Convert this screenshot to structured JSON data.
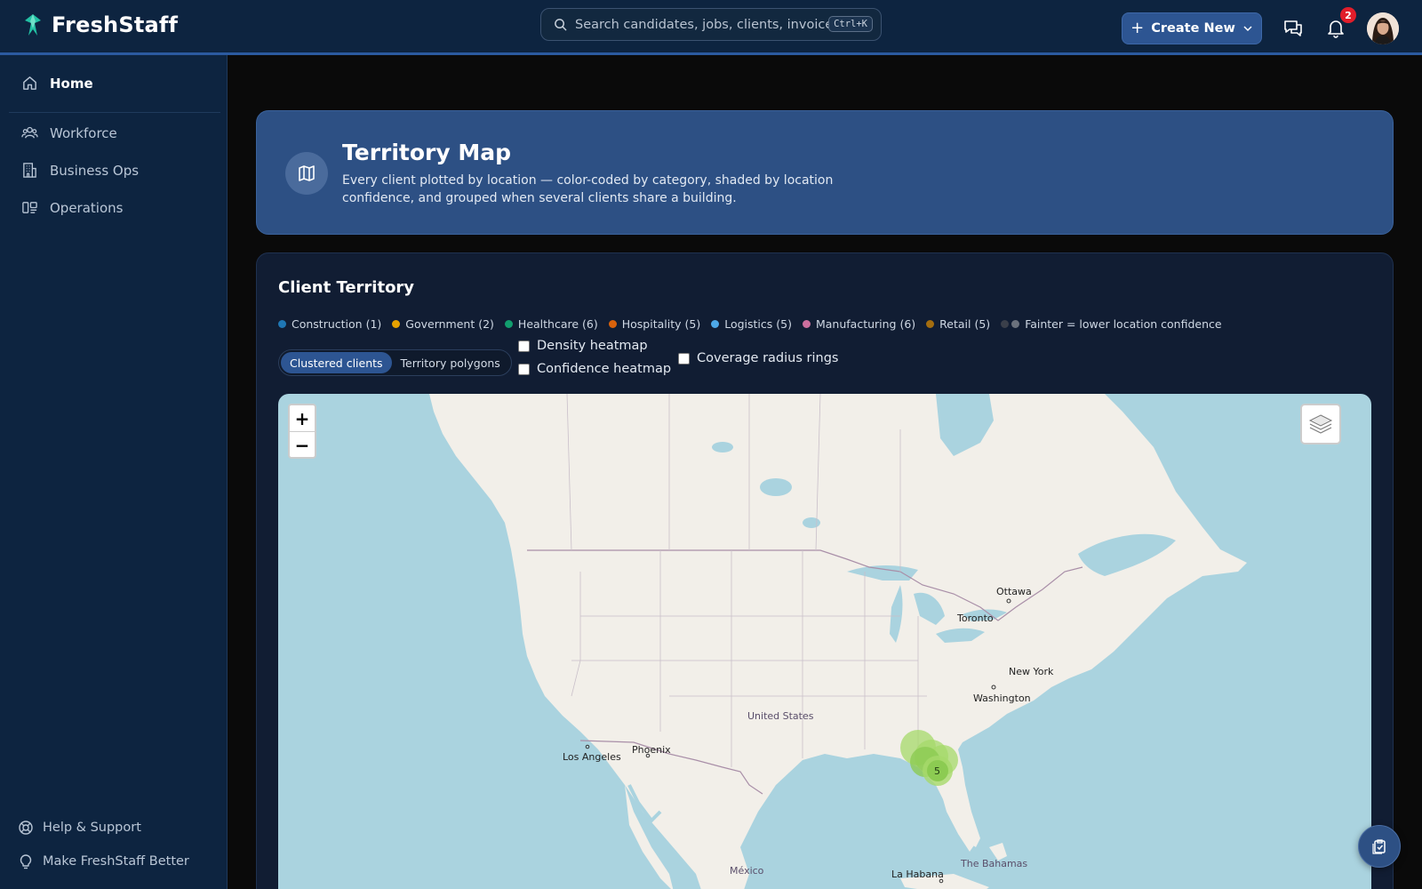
{
  "app": {
    "name": "FreshStaff"
  },
  "header": {
    "search_placeholder": "Search candidates, jobs, clients, invoices...",
    "search_shortcut": "Ctrl+K",
    "create_label": "Create New",
    "notification_count": "2",
    "icons": [
      "brand-logo-icon",
      "search-icon",
      "plus-icon",
      "chevron-down-icon",
      "chat-icon",
      "bell-icon",
      "avatar"
    ]
  },
  "sidebar": {
    "items": [
      {
        "label": "Home",
        "icon": "home-icon",
        "active": true
      },
      {
        "label": "Workforce",
        "icon": "users-icon"
      },
      {
        "label": "Business Ops",
        "icon": "building-icon"
      },
      {
        "label": "Operations",
        "icon": "operations-icon"
      }
    ],
    "footer": [
      {
        "label": "Help & Support",
        "icon": "lifebuoy-icon"
      },
      {
        "label": "Make FreshStaff Better",
        "icon": "lightbulb-icon"
      }
    ]
  },
  "hero": {
    "title": "Territory Map",
    "subtitle": "Every client plotted by location — color-coded by category, shaded by location confidence, and grouped when several clients share a building."
  },
  "territory": {
    "title": "Client Territory",
    "legend": [
      {
        "label": "Construction (1)",
        "color": "#1f77b4"
      },
      {
        "label": "Government (2)",
        "color": "#e6a100"
      },
      {
        "label": "Healthcare (6)",
        "color": "#129e6e"
      },
      {
        "label": "Hospitality (5)",
        "color": "#d9620c"
      },
      {
        "label": "Logistics (5)",
        "color": "#4da8e8"
      },
      {
        "label": "Manufacturing (6)",
        "color": "#cc6f9e"
      },
      {
        "label": "Retail (5)",
        "color": "#a46d0f"
      }
    ],
    "legend_note": "Fainter = lower location confidence",
    "view_modes": [
      {
        "label": "Clustered clients",
        "active": true
      },
      {
        "label": "Territory polygons",
        "active": false
      }
    ],
    "checkboxes": {
      "density": "Density heatmap",
      "confidence": "Confidence heatmap",
      "coverage": "Coverage radius rings"
    }
  },
  "map": {
    "zoom_in": "+",
    "zoom_out": "−",
    "labels": {
      "ottawa": "Ottawa",
      "toronto": "Toronto",
      "new_york": "New York",
      "washington": "Washington",
      "united_states": "United States",
      "los_angeles": "Los Angeles",
      "phoenix": "Phoenix",
      "mexico": "México",
      "la_habana": "La Habana",
      "bahamas": "The Bahamas"
    },
    "cluster_count": "5"
  }
}
